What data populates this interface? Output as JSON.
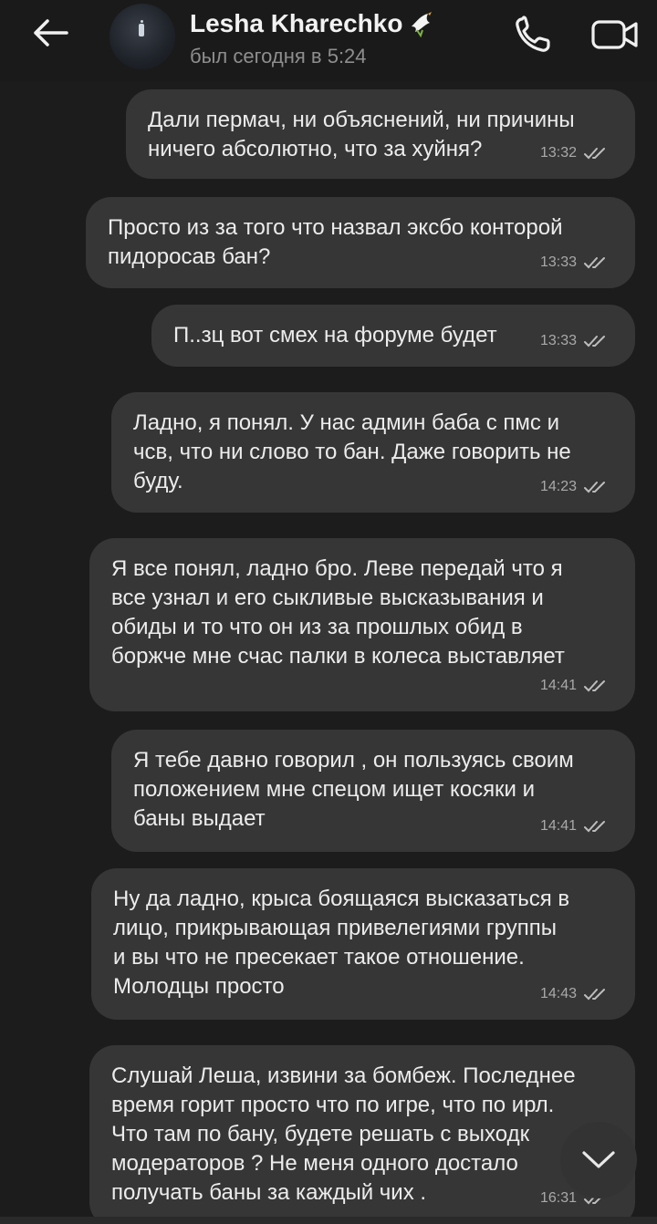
{
  "header": {
    "contact_name": "Lesha Kharechko",
    "status": "был сегодня в 5:24",
    "back_icon": "arrow-left-icon",
    "call_icon": "phone-icon",
    "video_icon": "video-camera-icon",
    "name_emoji": "dove-icon"
  },
  "messages": [
    {
      "lines": [
        "Дали пермач, ни объяснений, ни причины",
        "ничего абсолютно, что за хуйня?"
      ],
      "time": "13:32",
      "read": true
    },
    {
      "lines": [
        "Просто из за того что назвал эксбо конторой",
        "пидоросав бан?"
      ],
      "time": "13:33",
      "read": true
    },
    {
      "lines": [
        "П..зц вот смех на форуме будет"
      ],
      "time": "13:33",
      "read": true
    },
    {
      "lines": [
        "Ладно, я понял. У нас админ баба с пмс и",
        "чсв, что ни слово то бан. Даже говорить не",
        "буду."
      ],
      "time": "14:23",
      "read": true
    },
    {
      "lines": [
        "Я все понял, ладно бро. Леве передай что я",
        "все узнал и его сыкливые высказывания и",
        "обиды и то что он из за прошлых обид в",
        "боржче мне счас палки в колеса выставляет"
      ],
      "time": "14:41",
      "read": true
    },
    {
      "lines": [
        "Я тебе давно говорил , он пользуясь своим",
        "положением мне спецом ищет косяки и",
        "баны выдает"
      ],
      "time": "14:41",
      "read": true
    },
    {
      "lines": [
        "Ну да ладно, крыса боящаяся высказаться в",
        "лицо, прикрывающая привелегиями группы",
        "и вы что не пресекает такое отношение.",
        "Молодцы просто"
      ],
      "time": "14:43",
      "read": true
    },
    {
      "lines": [
        "Слушай Леша, извини за бомбеж. Последнее",
        "время горит просто что по игре, что по ирл.",
        "Что там по бану, будете решать с выходк",
        "модераторов ? Не меня одного достало",
        "получать баны за каждый чих ."
      ],
      "time": "16:31",
      "read": true
    }
  ],
  "scroll_down_icon": "chevron-down-icon"
}
